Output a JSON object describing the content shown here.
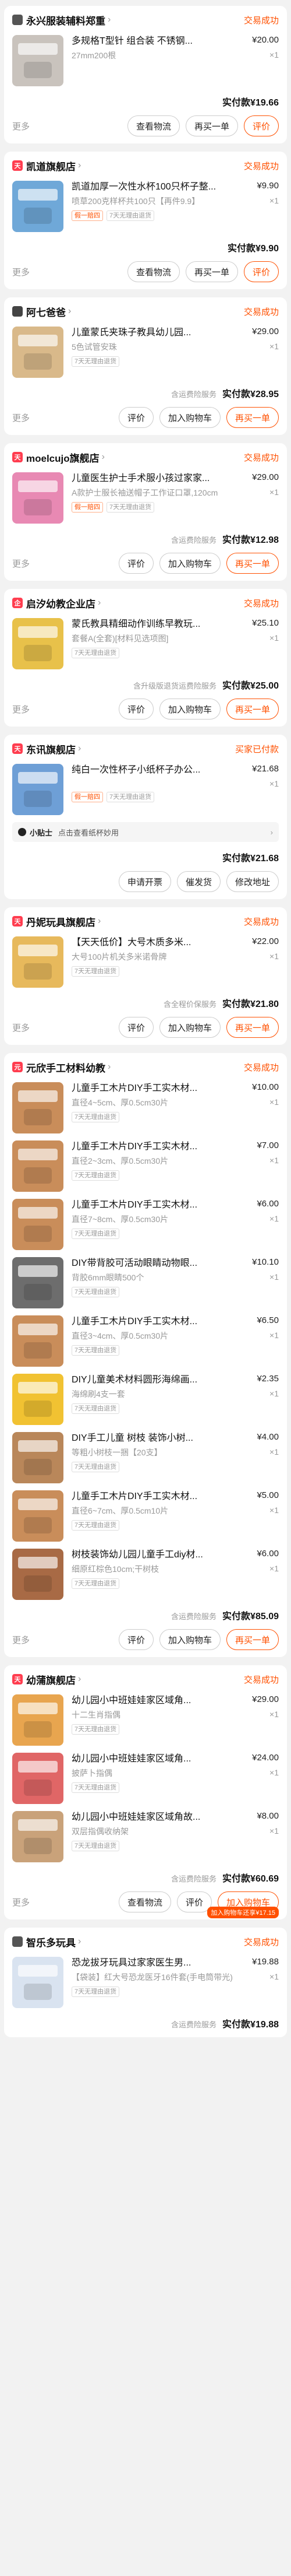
{
  "orders": [
    {
      "shop": "永兴服装辅料郑重",
      "status": "交易成功",
      "icon_color": "#555555",
      "icon_text": "",
      "items": [
        {
          "title": "多规格T型针 组合装 不锈钢...",
          "price": "¥20.00",
          "spec": "27mm200根",
          "qty": "×1",
          "tags": [],
          "thumb_color": "#c9c3bd"
        }
      ],
      "service": "",
      "total": "实付款¥19.66",
      "actions": [
        "查看物流",
        "再买一单",
        "评价"
      ],
      "primary": "评价",
      "show_more": true,
      "tip": null
    },
    {
      "shop": "凯道旗舰店",
      "status": "交易成功",
      "icon_color": "#ff3d4f",
      "icon_text": "天",
      "items": [
        {
          "title": "凯道加厚一次性水杯100只杯子整...",
          "price": "¥9.90",
          "spec": "喷草200克样杯共100只【再件9.9】",
          "qty": "×1",
          "tags": [
            "假一赔四",
            "7天无理由退货"
          ],
          "thumb_color": "#6fa8d8"
        }
      ],
      "service": "",
      "total": "实付款¥9.90",
      "actions": [
        "查看物流",
        "再买一单",
        "评价"
      ],
      "primary": "评价",
      "show_more": true,
      "tip": null
    },
    {
      "shop": "阿七爸爸",
      "status": "交易成功",
      "icon_color": "#444444",
      "icon_text": "",
      "items": [
        {
          "title": "儿童蒙氏夹珠子教具幼儿园...",
          "price": "¥29.00",
          "spec": "5色试管安珠",
          "qty": "×1",
          "tags": [
            "7天无理由退货"
          ],
          "thumb_color": "#d9b98a"
        }
      ],
      "service": "含运费险服务",
      "total": "实付款¥28.95",
      "actions": [
        "评价",
        "加入购物车",
        "再买一单"
      ],
      "primary": "再买一单",
      "show_more": true,
      "tip": null
    },
    {
      "shop": "moelcujo旗舰店",
      "status": "交易成功",
      "icon_color": "#ff3d4f",
      "icon_text": "天",
      "items": [
        {
          "title": "儿童医生护士手术服小孩过家家...",
          "price": "¥29.00",
          "spec": "A款护士服长袖送帽子工作证口罩,120cm",
          "qty": "×1",
          "tags": [
            "假一赔四",
            "7天无理由退货"
          ],
          "thumb_color": "#e889b3"
        }
      ],
      "service": "含运费险服务",
      "total": "实付款¥12.98",
      "actions": [
        "评价",
        "加入购物车",
        "再买一单"
      ],
      "primary": "再买一单",
      "show_more": true,
      "tip": null
    },
    {
      "shop": "启汐幼教企业店",
      "status": "交易成功",
      "icon_color": "#ff3d4f",
      "icon_text": "企",
      "items": [
        {
          "title": "蒙氏教具精细动作训练早教玩...",
          "price": "¥25.10",
          "spec": "套餐A(全套)[材料见选项图]",
          "qty": "×1",
          "tags": [
            "7天无理由退货"
          ],
          "thumb_color": "#e8c14a"
        }
      ],
      "service": "含升级版退货运费险服务",
      "total": "实付款¥25.00",
      "actions": [
        "评价",
        "加入购物车",
        "再买一单"
      ],
      "primary": "再买一单",
      "show_more": true,
      "tip": null
    },
    {
      "shop": "东讯旗舰店",
      "status": "买家已付款",
      "icon_color": "#ff3d4f",
      "icon_text": "天",
      "items": [
        {
          "title": "纯白一次性杯子小纸杯子办公...",
          "price": "¥21.68",
          "spec": "",
          "qty": "×1",
          "tags": [
            "假一赔四",
            "7天无理由退货"
          ],
          "thumb_color": "#6e9fd6"
        }
      ],
      "service": "",
      "total": "实付款¥21.68",
      "actions": [
        "申请开票",
        "催发货",
        "修改地址"
      ],
      "primary": "",
      "show_more": false,
      "tip": {
        "label": "小贴士",
        "text": "点击查看纸杯妙用"
      }
    },
    {
      "shop": "丹妮玩具旗舰店",
      "status": "交易成功",
      "icon_color": "#ff3d4f",
      "icon_text": "天",
      "items": [
        {
          "title": "【天天低价】大号木质多米...",
          "price": "¥22.00",
          "spec": "大号100片机关多米诺骨牌",
          "qty": "×1",
          "tags": [
            "7天无理由退货"
          ],
          "thumb_color": "#e7b95c"
        }
      ],
      "service": "含全程价保服务",
      "total": "实付款¥21.80",
      "actions": [
        "评价",
        "加入购物车",
        "再买一单"
      ],
      "primary": "再买一单",
      "show_more": true,
      "tip": null
    },
    {
      "shop": "元欣手工材料幼教",
      "status": "交易成功",
      "icon_color": "#ff3d4f",
      "icon_text": "元",
      "items": [
        {
          "title": "儿童手工木片DIY手工实木材...",
          "price": "¥10.00",
          "spec": "直径4~5cm、厚0.5cm30片",
          "qty": "×1",
          "tags": [
            "7天无理由退货"
          ],
          "thumb_color": "#c98d5a"
        },
        {
          "title": "儿童手工木片DIY手工实木材...",
          "price": "¥7.00",
          "spec": "直径2~3cm、厚0.5cm30片",
          "qty": "×1",
          "tags": [
            "7天无理由退货"
          ],
          "thumb_color": "#c98d5a"
        },
        {
          "title": "儿童手工木片DIY手工实木材...",
          "price": "¥6.00",
          "spec": "直径7~8cm、厚0.5cm30片",
          "qty": "×1",
          "tags": [
            "7天无理由退货"
          ],
          "thumb_color": "#c98d5a"
        },
        {
          "title": "DIY带背胶可活动眼睛动物眼...",
          "price": "¥10.10",
          "spec": "背胶6mm眼睛500个",
          "qty": "×1",
          "tags": [
            "7天无理由退货"
          ],
          "thumb_color": "#6d6d6d"
        },
        {
          "title": "儿童手工木片DIY手工实木材...",
          "price": "¥6.50",
          "spec": "直径3~4cm、厚0.5cm30片",
          "qty": "×1",
          "tags": [
            "7天无理由退货"
          ],
          "thumb_color": "#c98d5a"
        },
        {
          "title": "DIY儿童美术材料圆形海绵画...",
          "price": "¥2.35",
          "spec": "海绵刷4支一套",
          "qty": "×1",
          "tags": [
            "7天无理由退货"
          ],
          "thumb_color": "#f1c232"
        },
        {
          "title": "DIY手工儿童 树枝 装饰小树...",
          "price": "¥4.00",
          "spec": "等粗小树枝一捆【20支】",
          "qty": "×1",
          "tags": [
            "7天无理由退货"
          ],
          "thumb_color": "#b9875a"
        },
        {
          "title": "儿童手工木片DIY手工实木材...",
          "price": "¥5.00",
          "spec": "直径6~7cm、厚0.5cm10片",
          "qty": "×1",
          "tags": [
            "7天无理由退货"
          ],
          "thumb_color": "#c98d5a"
        },
        {
          "title": "树枝装饰幼儿园儿童手工diy材...",
          "price": "¥6.00",
          "spec": "细原红棕色10cm;干树枝",
          "qty": "×1",
          "tags": [
            "7天无理由退货"
          ],
          "thumb_color": "#a86a45"
        }
      ],
      "service": "含运费险服务",
      "total": "实付款¥85.09",
      "actions": [
        "评价",
        "加入购物车",
        "再买一单"
      ],
      "primary": "再买一单",
      "show_more": true,
      "tip": null
    },
    {
      "shop": "幼蒲旗舰店",
      "status": "交易成功",
      "icon_color": "#ff3d4f",
      "icon_text": "天",
      "items": [
        {
          "title": "幼儿园小中班娃娃家区域角...",
          "price": "¥29.00",
          "spec": "十二生肖指偶",
          "qty": "×1",
          "tags": [
            "7天无理由退货"
          ],
          "thumb_color": "#e8a54f"
        },
        {
          "title": "幼儿园小中班娃娃家区域角...",
          "price": "¥24.00",
          "spec": "披萨卜指偶",
          "qty": "×1",
          "tags": [
            "7天无理由退货"
          ],
          "thumb_color": "#e06666"
        },
        {
          "title": "幼儿园小中班娃娃家区域角故...",
          "price": "¥8.00",
          "spec": "双层指偶收纳架",
          "qty": "×1",
          "tags": [
            "7天无理由退货"
          ],
          "thumb_color": "#c9a27a"
        }
      ],
      "service": "含运费险服务",
      "total": "实付款¥60.69",
      "actions": [
        "查看物流",
        "评价",
        "加入购物车"
      ],
      "primary": "加入购物车",
      "show_more": true,
      "tip": null,
      "badge": "加入购物车还享¥17.15"
    },
    {
      "shop": "智乐多玩具",
      "status": "交易成功",
      "icon_color": "#555555",
      "icon_text": "",
      "items": [
        {
          "title": "恐龙拔牙玩具过家家医生男...",
          "price": "¥19.88",
          "spec": "【袋装】红大号恐龙医牙16件套(手电筒带光)",
          "qty": "×1",
          "tags": [
            "7天无理由退货"
          ],
          "thumb_color": "#d9e3f0"
        }
      ],
      "service": "含运费险服务",
      "total": "实付款¥19.88",
      "actions": [],
      "primary": "",
      "show_more": false,
      "tip": null
    }
  ],
  "more_label": "更多",
  "arrow": "›"
}
